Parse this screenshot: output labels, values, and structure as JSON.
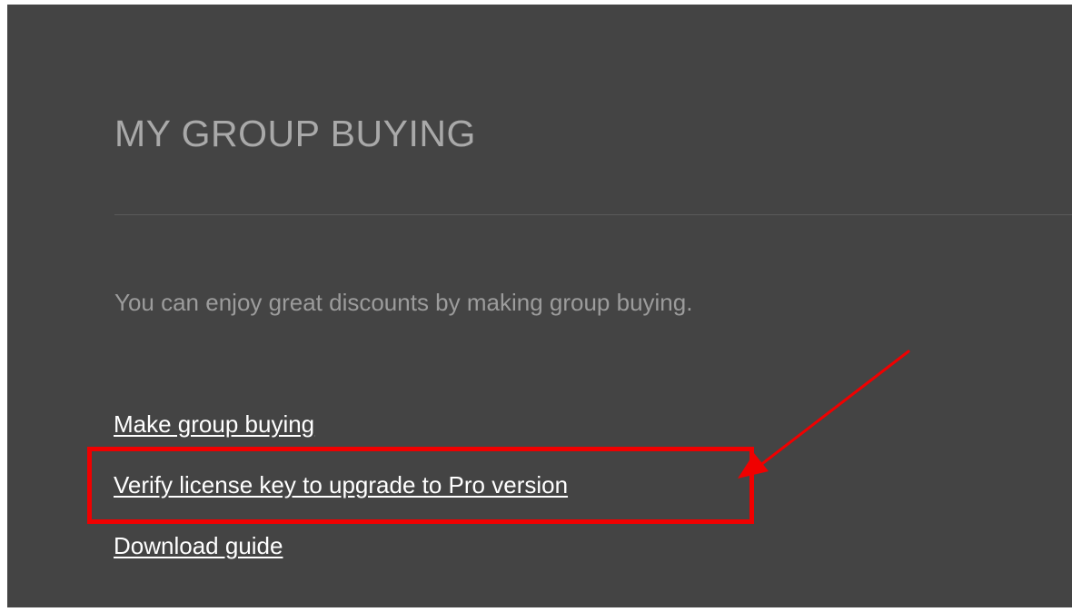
{
  "page": {
    "title": "MY GROUP BUYING",
    "intro": "You can enjoy great discounts by making group buying."
  },
  "links": [
    {
      "label": "Make group buying"
    },
    {
      "label": "Verify license key to upgrade to Pro version"
    },
    {
      "label": "Download guide"
    }
  ],
  "annotation": {
    "color": "#f00000",
    "highlighted_link_index": 1
  },
  "colors": {
    "background": "#444444",
    "title": "#a9a9a9",
    "intro_text": "#9c9c9c",
    "link": "#ffffff"
  }
}
